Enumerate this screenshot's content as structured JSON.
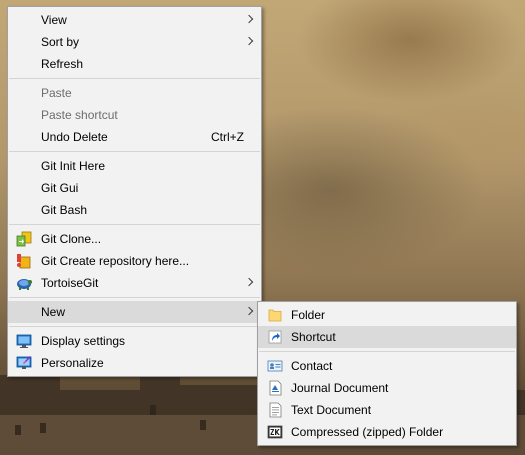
{
  "context_menu": {
    "items": [
      {
        "label": "View",
        "has_submenu": true
      },
      {
        "label": "Sort by",
        "has_submenu": true
      },
      {
        "label": "Refresh"
      },
      {
        "label": "Paste",
        "disabled": true
      },
      {
        "label": "Paste shortcut",
        "disabled": true
      },
      {
        "label": "Undo Delete",
        "shortcut": "Ctrl+Z"
      },
      {
        "label": "Git Init Here"
      },
      {
        "label": "Git Gui"
      },
      {
        "label": "Git Bash"
      },
      {
        "label": "Git Clone...",
        "icon": "git-clone-icon"
      },
      {
        "label": "Git Create repository here...",
        "icon": "git-create-repo-icon"
      },
      {
        "label": "TortoiseGit",
        "icon": "tortoisegit-icon",
        "has_submenu": true
      },
      {
        "label": "New",
        "has_submenu": true,
        "highlighted": true
      },
      {
        "label": "Display settings",
        "icon": "display-settings-icon"
      },
      {
        "label": "Personalize",
        "icon": "personalize-icon"
      }
    ]
  },
  "new_submenu": {
    "items": [
      {
        "label": "Folder",
        "icon": "folder-icon"
      },
      {
        "label": "Shortcut",
        "icon": "shortcut-icon",
        "highlighted": true
      },
      {
        "label": "Contact",
        "icon": "contact-icon"
      },
      {
        "label": "Journal Document",
        "icon": "journal-document-icon"
      },
      {
        "label": "Text Document",
        "icon": "text-document-icon"
      },
      {
        "label": "Compressed (zipped) Folder",
        "icon": "zip-folder-icon"
      }
    ]
  },
  "colors": {
    "menu_bg": "#f2f2f2",
    "menu_border": "#a0a0a0",
    "highlight": "#dadada",
    "disabled_text": "#6d6d6d"
  }
}
